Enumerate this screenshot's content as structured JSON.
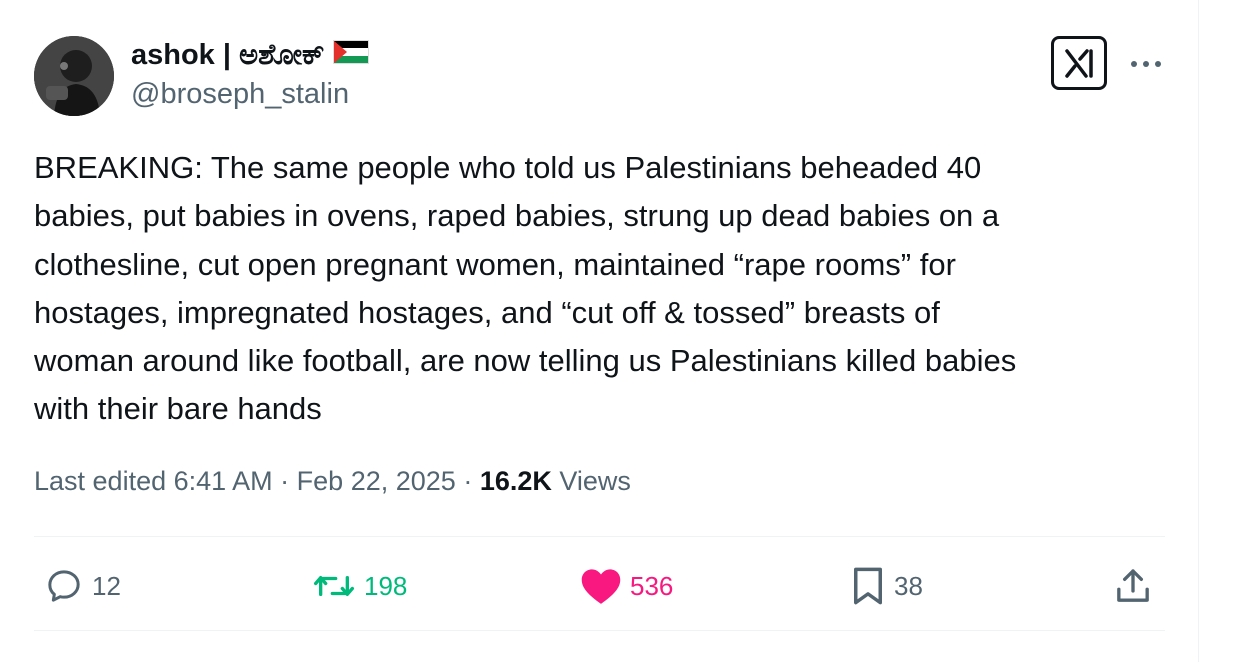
{
  "author": {
    "display_name": "ashok | ಅಶೋಕ್",
    "flag_icon": "palestine-flag-icon",
    "handle": "@broseph_stalin",
    "avatar_icon": "avatar-photo"
  },
  "header": {
    "grok_icon": "grok-icon",
    "more_icon": "more-horizontal-icon"
  },
  "tweet": {
    "lines": [
      "BREAKING: The same people who told us Palestinians beheaded 40",
      "babies, put babies in ovens, raped babies, strung up dead babies on a",
      "clothesline, cut open pregnant women, maintained “rape rooms” for",
      "hostages, impregnated hostages, and “cut off & tossed” breasts of",
      "woman around like football, are now telling us Palestinians killed babies",
      "with their bare hands"
    ]
  },
  "meta": {
    "edited": "Last edited 6:41 AM",
    "separator": " · ",
    "date": "Feb 22, 2025",
    "views_count": "16.2K",
    "views_label": "Views"
  },
  "actions": {
    "reply_count": "12",
    "retweet_count": "198",
    "like_count": "536",
    "bookmark_count": "38"
  },
  "colors": {
    "retweet": "#00ba7c",
    "like": "#f91880",
    "secondary": "#536471",
    "text": "#0f1419"
  }
}
